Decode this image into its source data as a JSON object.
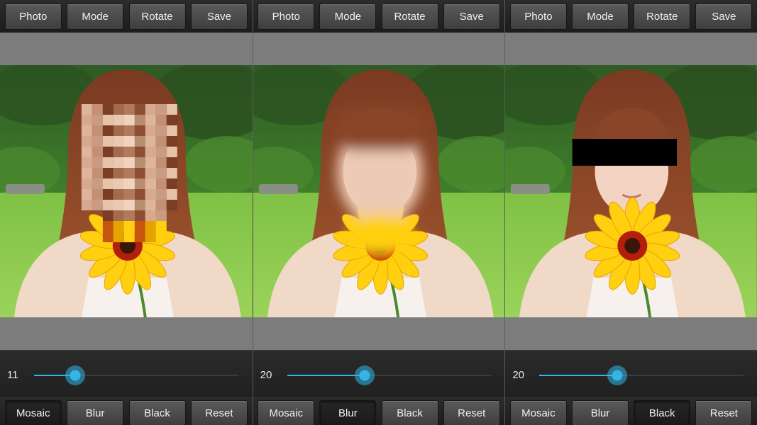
{
  "panels": [
    {
      "top_buttons": [
        "Photo",
        "Mode",
        "Rotate",
        "Save"
      ],
      "effect": "mosaic",
      "slider": {
        "value": "11",
        "level": 0.2
      },
      "bottom_buttons": [
        "Mosaic",
        "Blur",
        "Black",
        "Reset"
      ],
      "active_bottom": 0
    },
    {
      "top_buttons": [
        "Photo",
        "Mode",
        "Rotate",
        "Save"
      ],
      "effect": "blur",
      "slider": {
        "value": "20",
        "level": 0.38
      },
      "bottom_buttons": [
        "Mosaic",
        "Blur",
        "Black",
        "Reset"
      ],
      "active_bottom": 1
    },
    {
      "top_buttons": [
        "Photo",
        "Mode",
        "Rotate",
        "Save"
      ],
      "effect": "black",
      "slider": {
        "value": "20",
        "level": 0.38
      },
      "bottom_buttons": [
        "Mosaic",
        "Blur",
        "Black",
        "Reset"
      ],
      "active_bottom": 2
    }
  ],
  "colors": {
    "accent": "#33b5e5",
    "panel_bg": "#7c7c7c",
    "toolbar_bg": "#1d1d1d"
  }
}
